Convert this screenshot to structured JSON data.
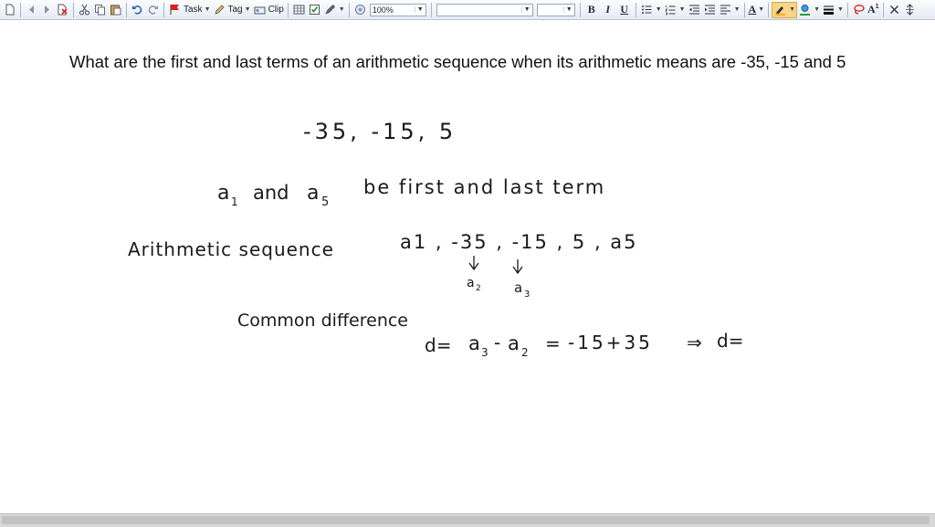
{
  "toolbar": {
    "task_label": "Task",
    "tag_label": "Tag",
    "clip_label": "Clip",
    "zoom_value": "100%",
    "font_name_value": "",
    "font_size_value": "",
    "bold_label": "B",
    "italic_label": "I",
    "underline_label": "U",
    "font_color_label": "A",
    "superscript_label": "A",
    "pen_color": "#f2b21f",
    "highlight_color": "#2f9a3a"
  },
  "page": {
    "question_text": "What are the first and last terms of an arithmetic sequence when its arithmetic means are -35, -15 and 5",
    "handwriting": {
      "line1": "-35, -15, 5",
      "line2_a1": "a",
      "line2_a1_sub": "1",
      "line2_and": "and",
      "line2_a5": "a",
      "line2_a5_sub": "5",
      "line2_rest": "be first and last term",
      "line3_label": "Arithmetic sequence",
      "line3_seq": "a1 , -35 , -15 , 5 , a5",
      "arrow1_label": "a",
      "arrow1_sub": "2",
      "arrow2_label": "a",
      "arrow2_sub": "3",
      "line4_label": "Common difference",
      "line5_d": "d=",
      "line5_a3": "a",
      "line5_a3_sub": "3",
      "line5_minus": "-",
      "line5_a2": "a",
      "line5_a2_sub": "2",
      "line5_eq": "=",
      "line5_expr": "-15+35",
      "line5_implies": "⇒",
      "line5_d2": "d="
    }
  }
}
